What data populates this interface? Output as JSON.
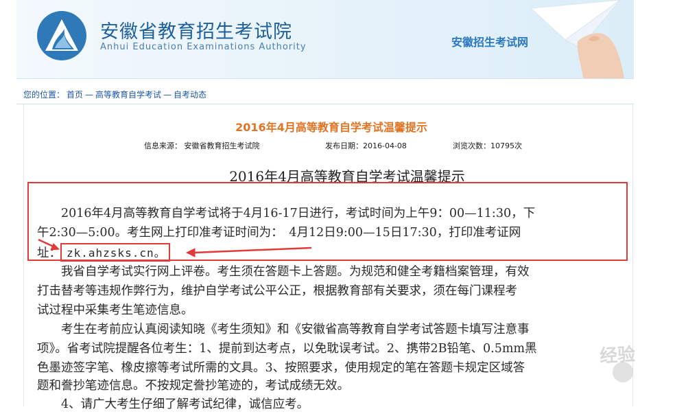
{
  "header": {
    "org_name_cn": "安徽省教育招生考试院",
    "org_name_en": "Anhui Education Examinations Authority",
    "site_name": "安徽招生考试网",
    "logo_icon": "mountain-logo-icon"
  },
  "breadcrumb": {
    "prefix": "您的位置：",
    "items": [
      "首页",
      "高等教育自学考试",
      "自考动态"
    ],
    "separator": "—"
  },
  "article": {
    "title": "2016年4月高等教育自学考试温馨提示",
    "meta": {
      "source_label": "信息来源：",
      "source": "安徽省教育招生考试院",
      "date_label": "发布日期：",
      "date": "2016-04-08",
      "views_label": "浏览次数：",
      "views": "10795次"
    },
    "body_title": "2016年4月高等教育自学考试温馨提示",
    "lines": [
      "　　2016年4月高等教育自学考试将于4月16-17日进行，考试时间为上午9：00—11:30，下",
      "午2:30—5:00。考生网上打印准考证时间为：　4月12日9:00—15日17:30，打印准考证网",
      "址："
    ],
    "url": "zk.ahzsks.cn。",
    "paragraph2_lines": [
      "　　我省自学考试实行网上评卷。考生须在答题卡上答题。为规范和健全考籍档案管理，有效",
      "打击替考等违规作弊行为，维护自学考试公平公正，根据教育部有关要求，须在每门课程考",
      "试过程中采集考生笔迹信息。"
    ],
    "paragraph3_lines": [
      "　　考生在考前应认真阅读知晓《考生须知》和《安徽省高等教育自学考试答题卡填写注意事",
      "项》。省考试院提醒各位考生：1、提前到达考点，以免耽误考试。2、携带2B铅笔、0.5mm黑",
      "色墨迹签字笔、橡皮擦等考试所需的文具。3、按照要求，使用规定的笔在答题卡规定区域答",
      "题和誊抄笔迹信息。不按规定誊抄笔迹的，考试成绩无效。"
    ],
    "paragraph4_partial": "　　4、请广大考生仔细了解考试纪律，诚信应考。"
  },
  "watermark": {
    "text": "经验"
  },
  "colors": {
    "title_orange": "#e07424",
    "link_blue": "#1d57a6",
    "annotation_red": "#e23a3a"
  }
}
